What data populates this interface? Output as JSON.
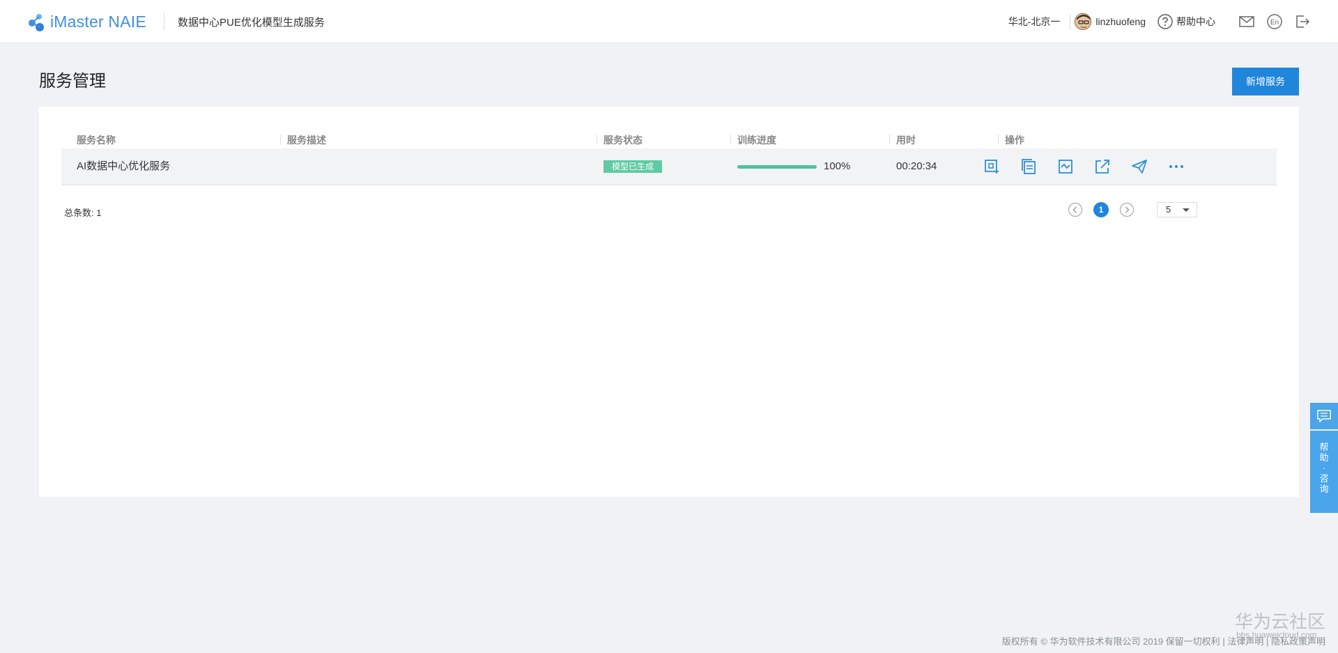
{
  "header": {
    "brand": "iMaster NAIE",
    "app_title": "数据中心PUE优化模型生成服务",
    "region": "华北-北京一",
    "username": "linzhuofeng",
    "help_label": "帮助中心"
  },
  "page": {
    "title": "服务管理",
    "add_button": "新增服务"
  },
  "table": {
    "columns": [
      "服务名称",
      "服务描述",
      "服务状态",
      "训练进度",
      "用时",
      "操作"
    ],
    "rows": [
      {
        "name": "AI数据中心优化服务",
        "description": "",
        "status": "模型已生成",
        "progress": 100,
        "progress_label": "100%",
        "duration": "00:20:34"
      }
    ]
  },
  "pagination": {
    "total_label": "总条数: 1",
    "current_page": "1",
    "page_size": "5"
  },
  "float_panel": {
    "chars": [
      "帮",
      "助",
      "·",
      "咨",
      "询"
    ]
  },
  "watermark": {
    "name": "华为云社区",
    "url": "bbs.huaweicloud.com"
  },
  "footer": {
    "copyright": "版权所有 © 华为软件技术有限公司 2019 保留一切权利",
    "legal": "法律声明",
    "privacy": "隐私政策声明",
    "sep": "|"
  },
  "colors": {
    "primary": "#1f86db",
    "status_green": "#5fcaa3",
    "progress_green": "#47c59d",
    "icon_blue": "#2b8fd8"
  }
}
